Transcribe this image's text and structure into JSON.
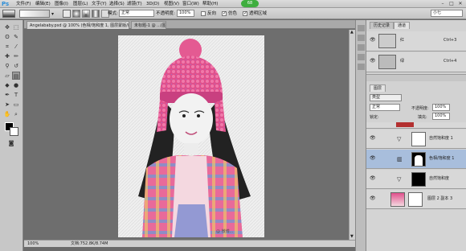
{
  "app": {
    "logo": "Ps"
  },
  "menu": [
    "文件(F)",
    "编辑(E)",
    "图像(I)",
    "图层(L)",
    "文字(Y)",
    "选择(S)",
    "滤镜(T)",
    "3D(D)",
    "视图(V)",
    "窗口(W)",
    "帮助(H)"
  ],
  "zoom_badge": "68",
  "window_controls": {
    "min": "–",
    "max": "□",
    "close": "✕"
  },
  "options_bar": {
    "mode_label": "模式:",
    "mode_value": "正常",
    "opacity_label": "不透明度:",
    "opacity_value": "100%",
    "reverse_label": "反向",
    "dither_label": "仿色",
    "transparency_label": "透明区域",
    "workspace_value": "小七"
  },
  "document_tabs": [
    {
      "label": "Angelababy.psd @ 100% (色相/饱和度 1, 图层蒙版/8) * ×",
      "active": true
    },
    {
      "label": "未标题-1 @ ...(图层蒙版/8) * ×",
      "active": false
    }
  ],
  "status_bar": {
    "zoom": "100%",
    "doc": "文档:752.8K/8.74M"
  },
  "watermark": "@ 微博...",
  "channels_panel": {
    "tabs": [
      "历史记录",
      "通道"
    ],
    "rows": [
      {
        "name": "红",
        "shortcut": "Ctrl+3"
      },
      {
        "name": "绿",
        "shortcut": "Ctrl+4"
      }
    ]
  },
  "layers_panel": {
    "tabs": [
      "图层"
    ],
    "kind_label": "类型",
    "blend_mode": "正常",
    "opacity_label": "不透明度:",
    "opacity_value": "100%",
    "lock_label": "锁定:",
    "fill_label": "填充:",
    "fill_value": "100%",
    "layers": [
      {
        "name": "自然饱和度 1",
        "selected": false,
        "mask": "white"
      },
      {
        "name": "色相/饱和度 1",
        "selected": true,
        "mask": "silhouette"
      },
      {
        "name": "自然饱和度",
        "selected": false,
        "mask": "black"
      },
      {
        "name": "图层 2 副本 3",
        "selected": false,
        "mask": "photo"
      }
    ]
  },
  "colors": {
    "accent_pink": "#e0508c",
    "selection": "#a8bedc",
    "photoshop_blue": "#2f8fd8"
  }
}
